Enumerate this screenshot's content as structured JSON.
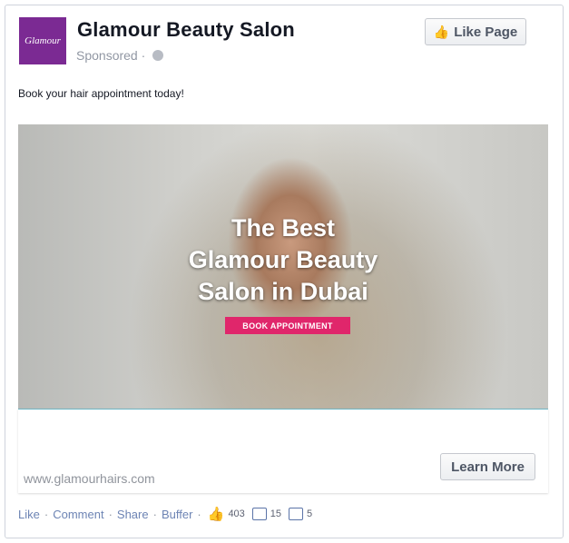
{
  "post": {
    "page_name": "Glamour Beauty Salon",
    "sponsored_label": "Sponsored",
    "sponsored_separator": "·",
    "avatar_text": "Glamour",
    "like_page_label": "Like Page",
    "message": "Book your hair appointment today!"
  },
  "creative": {
    "headline_line1": "The Best",
    "headline_line2": "Glamour Beauty",
    "headline_line3": "Salon in Dubai",
    "cta_label": "BOOK APPOINTMENT"
  },
  "link": {
    "domain": "www.glamourhairs.com",
    "button_label": "Learn More"
  },
  "actions": {
    "like": "Like",
    "comment": "Comment",
    "share": "Share",
    "buffer": "Buffer",
    "like_count": "403",
    "comment_count": "15",
    "share_count": "5",
    "separator": "·"
  },
  "icons": [
    "globe-icon",
    "thumbs-up-icon",
    "comment-icon",
    "share-icon"
  ],
  "colors": {
    "avatar_bg": "#7b2a93",
    "cta_bg": "#e0266b",
    "link_color": "#6d84b4"
  }
}
